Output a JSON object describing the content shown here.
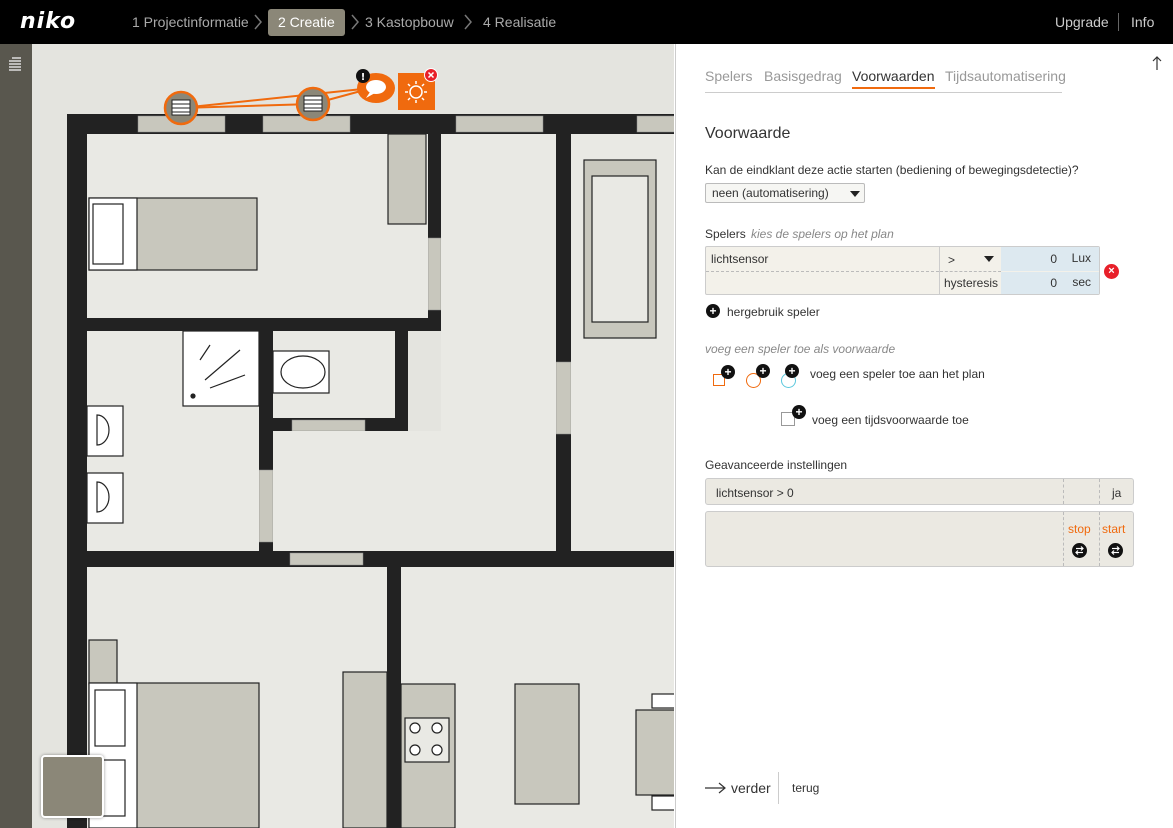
{
  "header": {
    "logo": "niko",
    "steps": [
      "1 Projectinformatie",
      "2 Creatie",
      "3 Kastopbouw",
      "4 Realisatie"
    ],
    "active_step": "2 Creatie",
    "links": [
      "Upgrade",
      "Info"
    ]
  },
  "panel": {
    "tabs": [
      "Spelers",
      "Basisgedrag",
      "Voorwaarden",
      "Tijdsautomatisering"
    ],
    "active_tab": "Voorwaarden",
    "heading": "Voorwaarde",
    "question": "Kan de eindklant deze actie starten (bediening of bewegingsdetectie)?",
    "select_value": "neen (automatisering)",
    "spelers_label": "Spelers",
    "spelers_hint": "kies de spelers op het plan",
    "speler_row": {
      "name": "lichtsensor",
      "operator": ">",
      "value": "0",
      "unit": "Lux",
      "hysteresis_label": "hysteresis",
      "hysteresis_value": "0",
      "hysteresis_unit": "sec"
    },
    "reuse_label": "hergebruik speler",
    "add_hint": "voeg een speler toe als voorwaarde",
    "add_plan_label": "voeg een speler toe aan het plan",
    "add_time_label": "voeg een tijdsvoorwaarde toe",
    "advanced_label": "Geavanceerde instellingen",
    "advanced_row": {
      "condition": "lichtsensor > 0",
      "value": "ja"
    },
    "advanced_actions": {
      "stop": "stop",
      "start": "start"
    },
    "nav": {
      "next": "verder",
      "back": "terug"
    }
  },
  "colors": {
    "accent": "#f06a0e",
    "topbar": "#000000",
    "active_step": "#8b8778",
    "value_cell": "#dde9f0",
    "delete": "#e8202a"
  }
}
